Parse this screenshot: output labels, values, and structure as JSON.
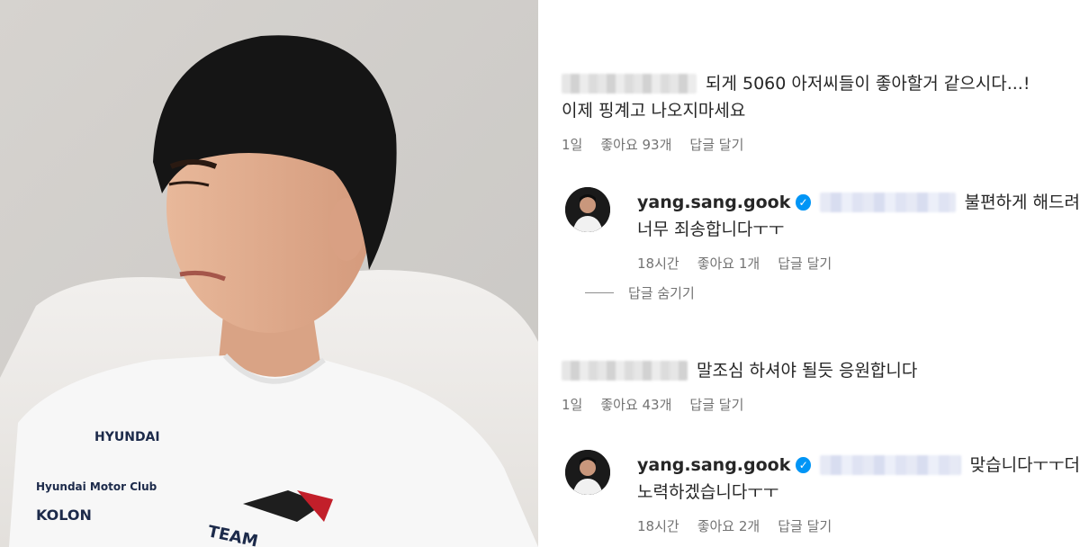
{
  "comments": [
    {
      "text": "되게 5060 아저씨들이 좋아할거 같으시다...!",
      "text2": "이제 핑계고 나오지마세요",
      "time": "1일",
      "likes": "좋아요 93개",
      "reply_btn": "답글 달기",
      "reply": {
        "username": "yang.sang.gook",
        "verified_glyph": "✓",
        "text": "불편하게 해드려",
        "text2": "너무 죄송합니다ㅜㅜ",
        "time": "18시간",
        "likes": "좋아요 1개",
        "reply_btn": "답글 달기"
      },
      "hide_replies": "답글 숨기기"
    },
    {
      "text": "말조심 하셔야 될듯 응원합니다",
      "time": "1일",
      "likes": "좋아요 43개",
      "reply_btn": "답글 달기",
      "reply": {
        "username": "yang.sang.gook",
        "verified_glyph": "✓",
        "text": "맞습니다ㅜㅜ더",
        "text2": "노력하겠습니다ㅜㅜ",
        "time": "18시간",
        "likes": "좋아요 2개",
        "reply_btn": "답글 달기"
      }
    }
  ],
  "photo": {
    "shirt_texts": [
      "HYUNDAI",
      "Hyundai Motor Club",
      "KOLON",
      "TEAM"
    ]
  },
  "colors": {
    "verified": "#0095f6",
    "meta": "#737373",
    "text": "#262626"
  }
}
